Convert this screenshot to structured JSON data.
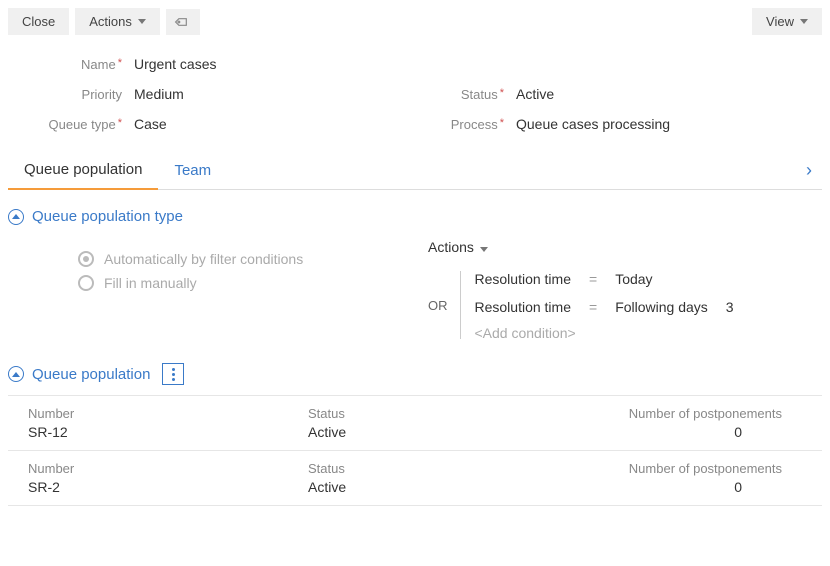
{
  "toolbar": {
    "close": "Close",
    "actions": "Actions",
    "view": "View"
  },
  "fields": {
    "name_label": "Name",
    "name_value": "Urgent cases",
    "priority_label": "Priority",
    "priority_value": "Medium",
    "status_label": "Status",
    "status_value": "Active",
    "queue_type_label": "Queue type",
    "queue_type_value": "Case",
    "process_label": "Process",
    "process_value": "Queue cases processing"
  },
  "tabs": {
    "tab1": "Queue population",
    "tab2": "Team"
  },
  "section_pop_type": {
    "title": "Queue population type",
    "opt_auto": "Automatically by filter conditions",
    "opt_manual": "Fill in manually"
  },
  "filter": {
    "actions": "Actions",
    "or": "OR",
    "cond1_field": "Resolution time",
    "cond1_op": "=",
    "cond1_val": "Today",
    "cond2_field": "Resolution time",
    "cond2_op": "=",
    "cond2_val": "Following days",
    "cond2_num": "3",
    "add": "<Add condition>"
  },
  "section_pop": {
    "title": "Queue population",
    "col_number": "Number",
    "col_status": "Status",
    "col_post": "Number of postponements",
    "rows": [
      {
        "number": "SR-12",
        "status": "Active",
        "post": "0"
      },
      {
        "number": "SR-2",
        "status": "Active",
        "post": "0"
      }
    ]
  }
}
